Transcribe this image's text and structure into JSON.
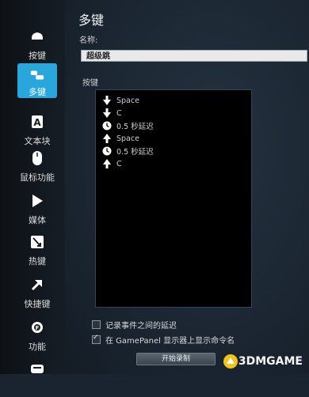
{
  "sidebar": {
    "items": [
      {
        "label": "按键",
        "icon": "mouse-button-icon"
      },
      {
        "label": "多键",
        "icon": "multikey-icon",
        "active": true
      },
      {
        "label": "文本块",
        "icon": "text-block-icon"
      },
      {
        "label": "鼠标功能",
        "icon": "mouse-icon"
      },
      {
        "label": "媒体",
        "icon": "play-icon"
      },
      {
        "label": "热键",
        "icon": "hotkey-icon"
      },
      {
        "label": "快捷键",
        "icon": "shortcut-arrow-icon"
      },
      {
        "label": "功能",
        "icon": "function-icon"
      },
      {
        "label": "",
        "icon": "bottom-icon"
      }
    ]
  },
  "main": {
    "title": "多键",
    "name_label": "名称:",
    "name_value": "超级跳",
    "keys_label": "按键",
    "key_events": [
      {
        "icon": "arrow-down-icon",
        "text": "Space"
      },
      {
        "icon": "arrow-down-icon",
        "text": "C"
      },
      {
        "icon": "clock-icon",
        "text": "0.5 秒延迟"
      },
      {
        "icon": "arrow-up-icon",
        "text": "Space"
      },
      {
        "icon": "clock-icon",
        "text": "0.5 秒延迟"
      },
      {
        "icon": "arrow-up-icon",
        "text": "C"
      }
    ],
    "options": [
      {
        "label": "记录事件之间的延迟",
        "checked": false
      },
      {
        "label": "在 GamePanel 显示器上显示命令名",
        "checked": true
      }
    ],
    "record_button": "开始录制"
  },
  "watermark": {
    "text": "3DMGAME"
  },
  "colors": {
    "accent": "#29a7dc",
    "list_bg": "#000000"
  }
}
